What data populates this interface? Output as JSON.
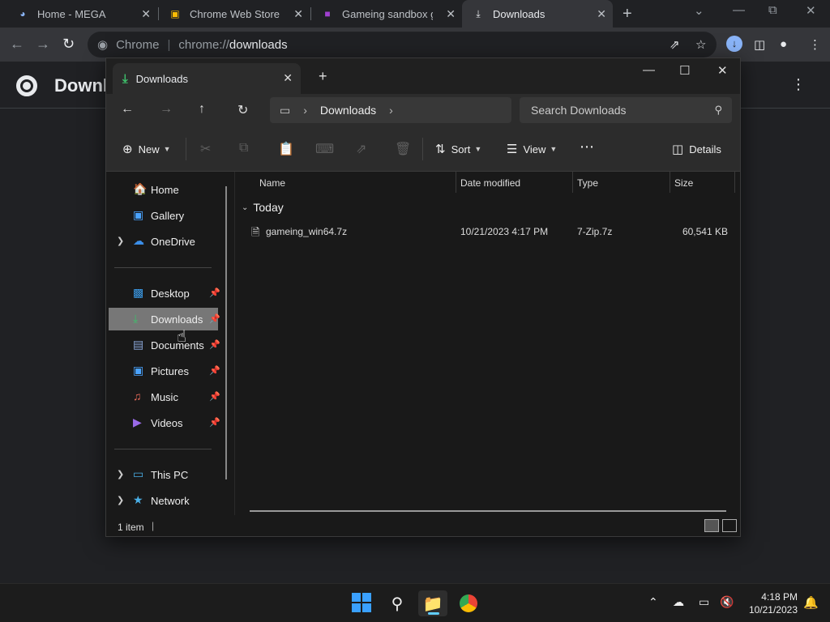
{
  "chrome": {
    "tabs": [
      {
        "title": "Home - MEGA",
        "icon": "mega-icon"
      },
      {
        "title": "Chrome Web Store - Ex",
        "icon": "webstore-icon"
      },
      {
        "title": "Gameing sandbox gam",
        "icon": "cube-icon"
      },
      {
        "title": "Downloads",
        "icon": "download-icon"
      }
    ],
    "omnibox": {
      "site": "Chrome",
      "url_prefix": "chrome://",
      "url_path": "downloads"
    },
    "page_title": "Downl"
  },
  "explorer": {
    "tab_title": "Downloads",
    "address": {
      "crumb": "Downloads"
    },
    "search_placeholder": "Search Downloads",
    "commands": {
      "new": "New",
      "sort": "Sort",
      "view": "View",
      "details": "Details"
    },
    "nav": {
      "home": "Home",
      "gallery": "Gallery",
      "onedrive": "OneDrive",
      "desktop": "Desktop",
      "downloads": "Downloads",
      "documents": "Documents",
      "pictures": "Pictures",
      "music": "Music",
      "videos": "Videos",
      "thispc": "This PC",
      "network": "Network"
    },
    "columns": {
      "name": "Name",
      "date": "Date modified",
      "type": "Type",
      "size": "Size"
    },
    "group": "Today",
    "files": [
      {
        "name": "gameing_win64.7z",
        "date": "10/21/2023 4:17 PM",
        "type": "7-Zip.7z",
        "size": "60,541 KB"
      }
    ],
    "status": "1 item"
  },
  "taskbar": {
    "time": "4:18 PM",
    "date": "10/21/2023"
  },
  "colors": {
    "accent": "#60cdff",
    "start": "#3aa0ff",
    "download_green": "#3ec06b",
    "selection": "#777777"
  }
}
